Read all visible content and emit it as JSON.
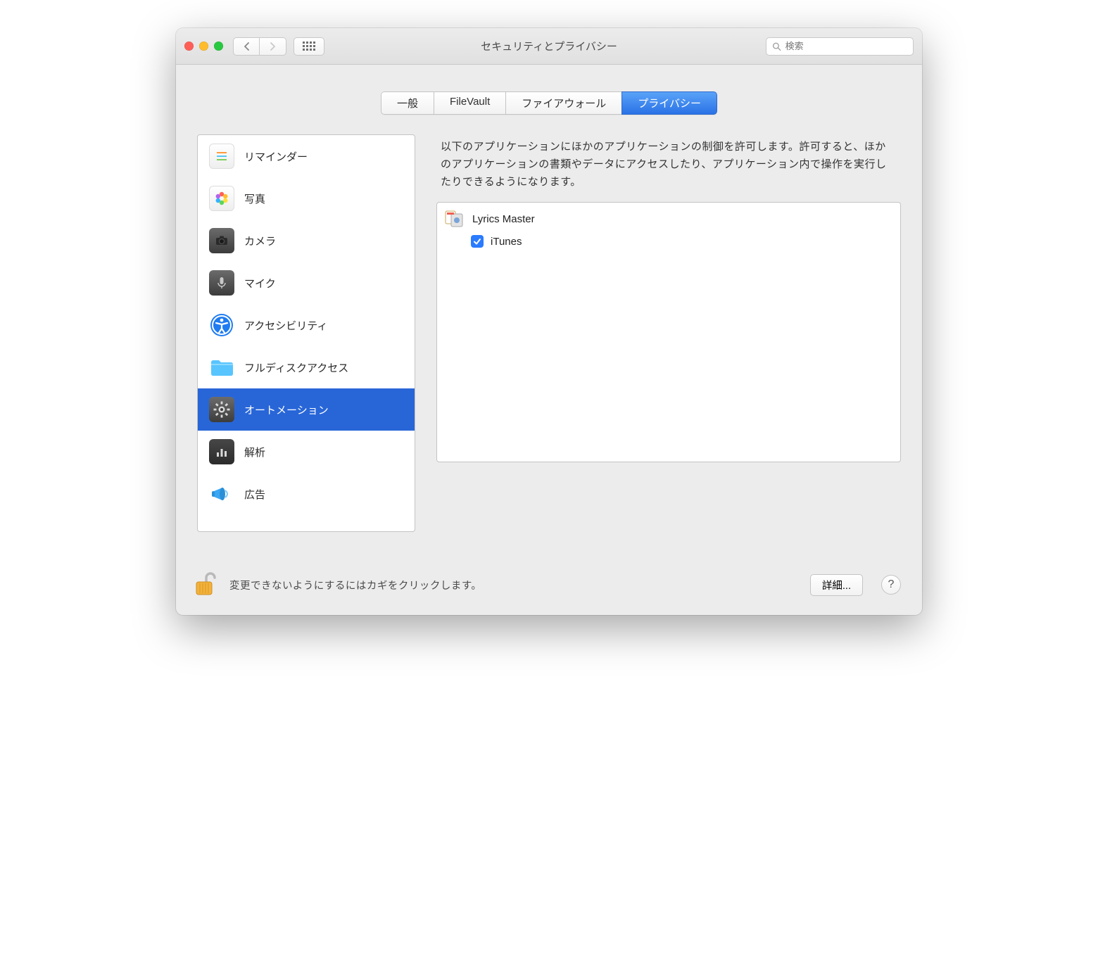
{
  "window": {
    "title": "セキュリティとプライバシー"
  },
  "search": {
    "placeholder": "検索"
  },
  "tabs": {
    "general": "一般",
    "filevault": "FileVault",
    "firewall": "ファイアウォール",
    "privacy": "プライバシー"
  },
  "sidebar": {
    "items": [
      {
        "label": "リマインダー"
      },
      {
        "label": "写真"
      },
      {
        "label": "カメラ"
      },
      {
        "label": "マイク"
      },
      {
        "label": "アクセシビリティ"
      },
      {
        "label": "フルディスクアクセス"
      },
      {
        "label": "オートメーション"
      },
      {
        "label": "解析"
      },
      {
        "label": "広告"
      }
    ]
  },
  "main": {
    "description": "以下のアプリケーションにほかのアプリケーションの制御を許可します。許可すると、ほかのアプリケーションの書類やデータにアクセスしたり、アプリケーション内で操作を実行したりできるようになります。",
    "app": {
      "name": "Lyrics Master"
    },
    "permission": {
      "label": "iTunes",
      "checked": true
    }
  },
  "footer": {
    "lock_text": "変更できないようにするにはカギをクリックします。",
    "advanced": "詳細...",
    "help": "?"
  }
}
